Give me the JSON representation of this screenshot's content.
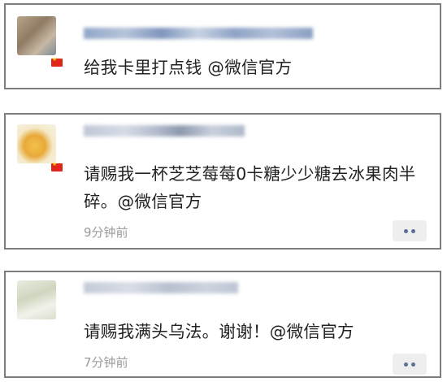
{
  "comments": [
    {
      "message": "给我卡里打点钱 @微信官方",
      "time": "",
      "has_more_button": false
    },
    {
      "message": "请赐我一杯芝芝莓莓0卡糖少少糖去冰果肉半碎。@微信官方",
      "time": "9分钟前",
      "has_more_button": true
    },
    {
      "message": "请赐我满头乌法。谢谢！@微信官方",
      "time": "7分钟前",
      "has_more_button": true
    }
  ],
  "icons": {
    "flag": "china-flag-icon",
    "more": "more-dots-icon"
  },
  "colors": {
    "border": "#7d7d7d",
    "text": "#222222",
    "time": "#9b9b9b",
    "more_button_bg": "#eeeeee",
    "more_dots": "#5c6e96",
    "flag_red": "#e0261b"
  }
}
